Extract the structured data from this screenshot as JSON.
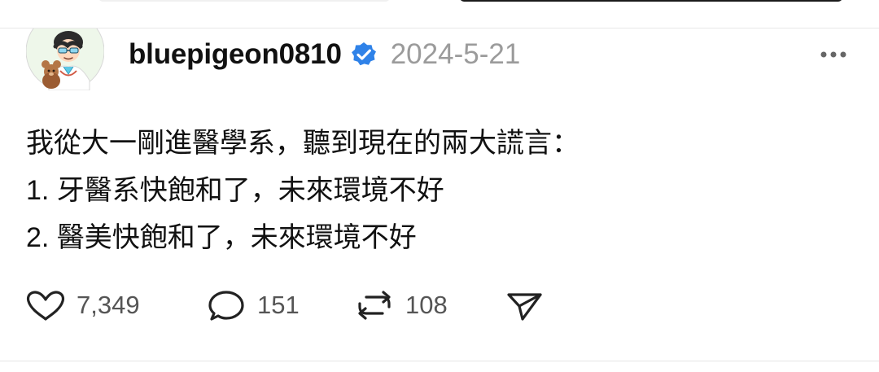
{
  "post": {
    "username": "bluepigeon0810",
    "verified_icon": "verified-badge-icon",
    "date": "2024-5-21",
    "more_icon": "more-options-icon",
    "text": "我從大一剛進醫學系，聽到現在的兩大謊言：\n1. 牙醫系快飽和了，未來環境不好\n2. 醫美快飽和了，未來環境不好",
    "actions": {
      "likes": "7,349",
      "comments": "151",
      "reposts": "108"
    }
  },
  "colors": {
    "verified": "#2f82e8",
    "muted": "#9b9b9b",
    "text": "#111111"
  }
}
